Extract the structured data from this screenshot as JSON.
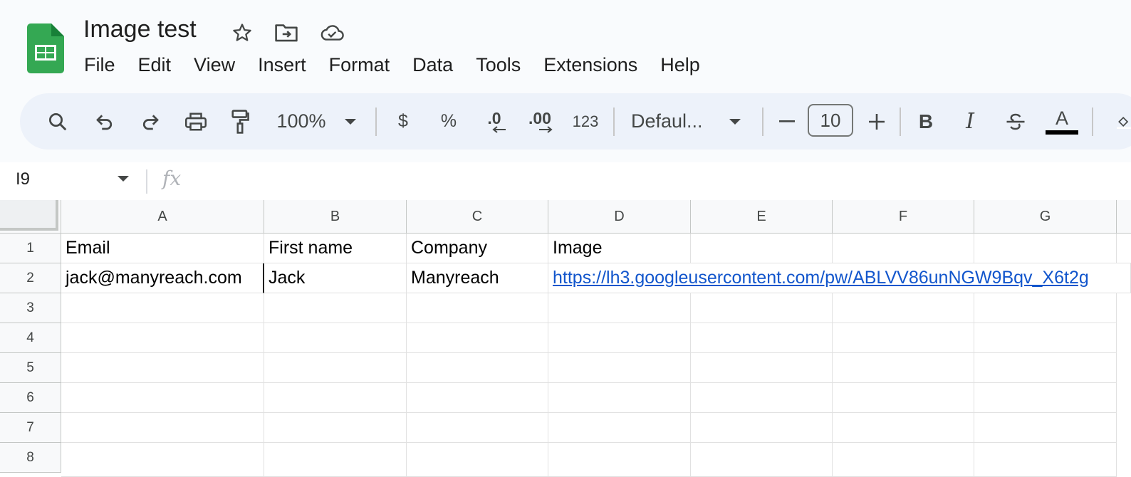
{
  "document": {
    "title": "Image test"
  },
  "header_icons": [
    "star-icon",
    "move-to-folder-icon",
    "cloud-saved-icon"
  ],
  "menu": [
    "File",
    "Edit",
    "View",
    "Insert",
    "Format",
    "Data",
    "Tools",
    "Extensions",
    "Help"
  ],
  "toolbar": {
    "zoom": "100%",
    "currency": "$",
    "percent": "%",
    "decrease_decimal": ".0",
    "increase_decimal": ".00",
    "number_format": "123",
    "font": "Defaul...",
    "font_size": "10",
    "bold": "B",
    "italic": "I",
    "text_color_letter": "A"
  },
  "formula_bar": {
    "cell_ref": "I9",
    "fx": "fx"
  },
  "grid": {
    "columns": [
      "A",
      "B",
      "C",
      "D",
      "E",
      "F",
      "G"
    ],
    "rows": [
      "1",
      "2",
      "3",
      "4",
      "5",
      "6",
      "7",
      "8"
    ],
    "cells": {
      "A1": "Email",
      "B1": "First name",
      "C1": "Company",
      "D1": "Image",
      "A2": "jack@manyreach.com",
      "B2": "Jack",
      "C2": "Manyreach",
      "D2": "https://lh3.googleusercontent.com/pw/ABLVV86unNGW9Bqv_X6t2g"
    }
  },
  "colors": {
    "accent_link": "#1155cc",
    "toolbar_bg": "#edf2fa",
    "logo_green": "#34a853"
  }
}
